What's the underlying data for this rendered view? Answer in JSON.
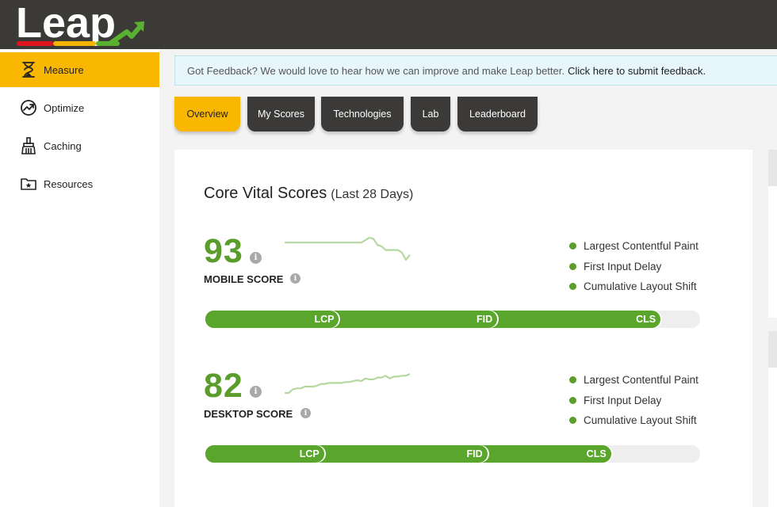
{
  "brand": {
    "logo_text": "Leap"
  },
  "sidebar": {
    "items": [
      {
        "label": "Measure",
        "icon": "hourglass-icon",
        "active": true
      },
      {
        "label": "Optimize",
        "icon": "trend-up-icon",
        "active": false
      },
      {
        "label": "Caching",
        "icon": "broom-icon",
        "active": false
      },
      {
        "label": "Resources",
        "icon": "folder-star-icon",
        "active": false
      }
    ]
  },
  "feedback": {
    "text": "Got Feedback? We would love to hear how we can improve and make Leap better.",
    "link": "Click here to submit feedback."
  },
  "tabs": [
    {
      "label": "Overview",
      "active": true
    },
    {
      "label": "My Scores",
      "active": false
    },
    {
      "label": "Technologies",
      "active": false
    },
    {
      "label": "Lab",
      "active": false
    },
    {
      "label": "Leaderboard",
      "active": false
    }
  ],
  "core_vitals": {
    "title": "Core Vital Scores",
    "subtitle": "(Last 28 Days)",
    "info_glyph": "i",
    "mobile": {
      "score": "93",
      "label": "MOBILE SCORE",
      "legend": [
        "Largest Contentful Paint",
        "First Input Delay",
        "Cumulative Layout Shift"
      ],
      "bar": [
        {
          "label": "LCP",
          "end_percent": 27
        },
        {
          "label": "FID",
          "end_percent": 59
        },
        {
          "label": "CLS",
          "end_percent": 92
        }
      ],
      "trend": [
        60,
        60,
        60,
        60,
        60,
        60,
        60,
        60,
        60,
        60,
        60,
        60,
        60,
        60,
        60,
        60,
        60,
        60,
        60,
        60,
        62,
        64,
        63,
        58,
        57,
        54,
        54,
        54,
        54,
        52,
        46,
        50
      ]
    },
    "desktop": {
      "score": "82",
      "label": "DESKTOP SCORE",
      "legend": [
        "Largest Contentful Paint",
        "First Input Delay",
        "Cumulative Layout Shift"
      ],
      "bar": [
        {
          "label": "LCP",
          "end_percent": 24
        },
        {
          "label": "FID",
          "end_percent": 57
        },
        {
          "label": "CLS",
          "end_percent": 82
        }
      ],
      "trend": [
        40,
        40,
        44,
        45,
        45,
        47,
        47,
        47,
        48,
        50,
        50,
        51,
        51,
        51,
        51,
        52,
        52,
        53,
        54,
        53,
        56,
        55,
        55,
        57,
        57,
        59,
        56,
        58,
        58,
        59,
        59,
        61
      ]
    }
  },
  "colors": {
    "accent": "#f9b700",
    "topbar": "#3c3a37",
    "score_green": "#5a9d2b",
    "bar_green": "#5aa52b",
    "trend_line": "#b6d8a0",
    "feedback_bg": "#e7f6fb"
  }
}
